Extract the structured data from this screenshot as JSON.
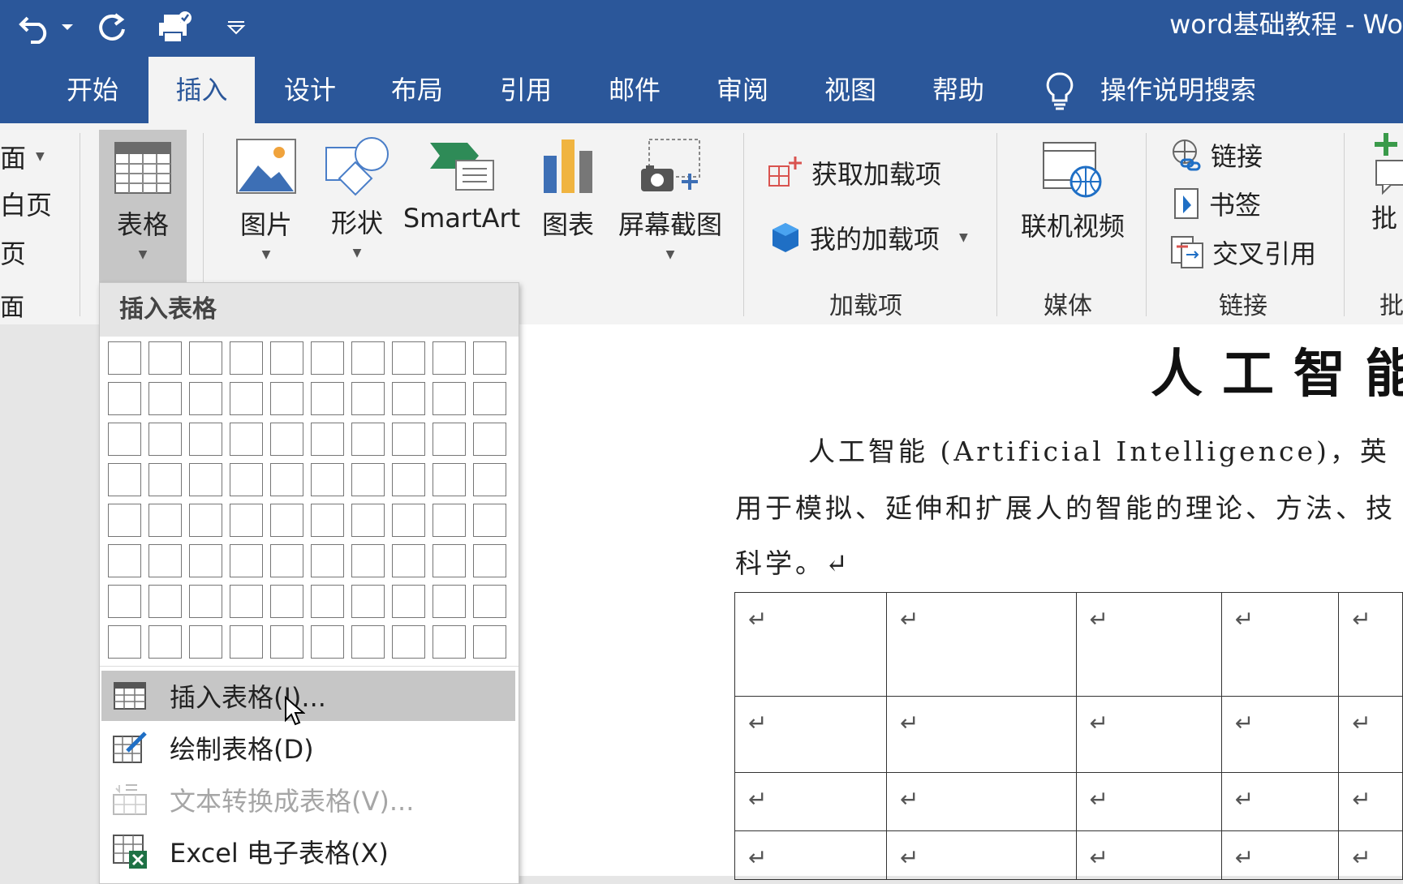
{
  "window": {
    "title": "word基础教程  -  Wo"
  },
  "tabs": [
    {
      "label": "开始"
    },
    {
      "label": "插入"
    },
    {
      "label": "设计"
    },
    {
      "label": "布局"
    },
    {
      "label": "引用"
    },
    {
      "label": "邮件"
    },
    {
      "label": "审阅"
    },
    {
      "label": "视图"
    },
    {
      "label": "帮助"
    }
  ],
  "active_tab": "插入",
  "tell_me": {
    "label": "操作说明搜索"
  },
  "ribbon": {
    "pages_partial": [
      "面",
      "白页",
      "页",
      "面"
    ],
    "table": {
      "label": "表格"
    },
    "illustrations": [
      {
        "label": "图片"
      },
      {
        "label": "形状"
      },
      {
        "label": "SmartArt"
      },
      {
        "label": "图表"
      },
      {
        "label": "屏幕截图"
      }
    ],
    "addins": {
      "get": "获取加载项",
      "mine": "我的加载项",
      "group": "加载项"
    },
    "media": {
      "online_video": "联机视频",
      "group": "媒体"
    },
    "links": {
      "link": "链接",
      "bookmark": "书签",
      "cross_ref": "交叉引用",
      "group": "链接"
    },
    "comments_partial": {
      "label": "批",
      "group": "批"
    }
  },
  "insert_table_menu": {
    "header": "插入表格",
    "grid": {
      "columns": 10,
      "rows": 8
    },
    "items": [
      {
        "label": "插入表格(I)...",
        "state": "hover"
      },
      {
        "label": "绘制表格(D)",
        "state": "normal"
      },
      {
        "label": "文本转换成表格(V)...",
        "state": "disabled"
      },
      {
        "label": "Excel 电子表格(X)",
        "state": "normal"
      }
    ]
  },
  "document": {
    "title_partial": "人工智能",
    "para_line1": "人工智能 (Artificial Intelligence)，英",
    "para_line2": "用于模拟、延伸和扩展人的智能的理论、方法、技",
    "para_line3": "科学。↵",
    "cell_mark": "↵"
  },
  "colors": {
    "accent": "#2b579a",
    "ribbon_bg": "#f3f3f3",
    "hover": "#c6c6c6"
  }
}
